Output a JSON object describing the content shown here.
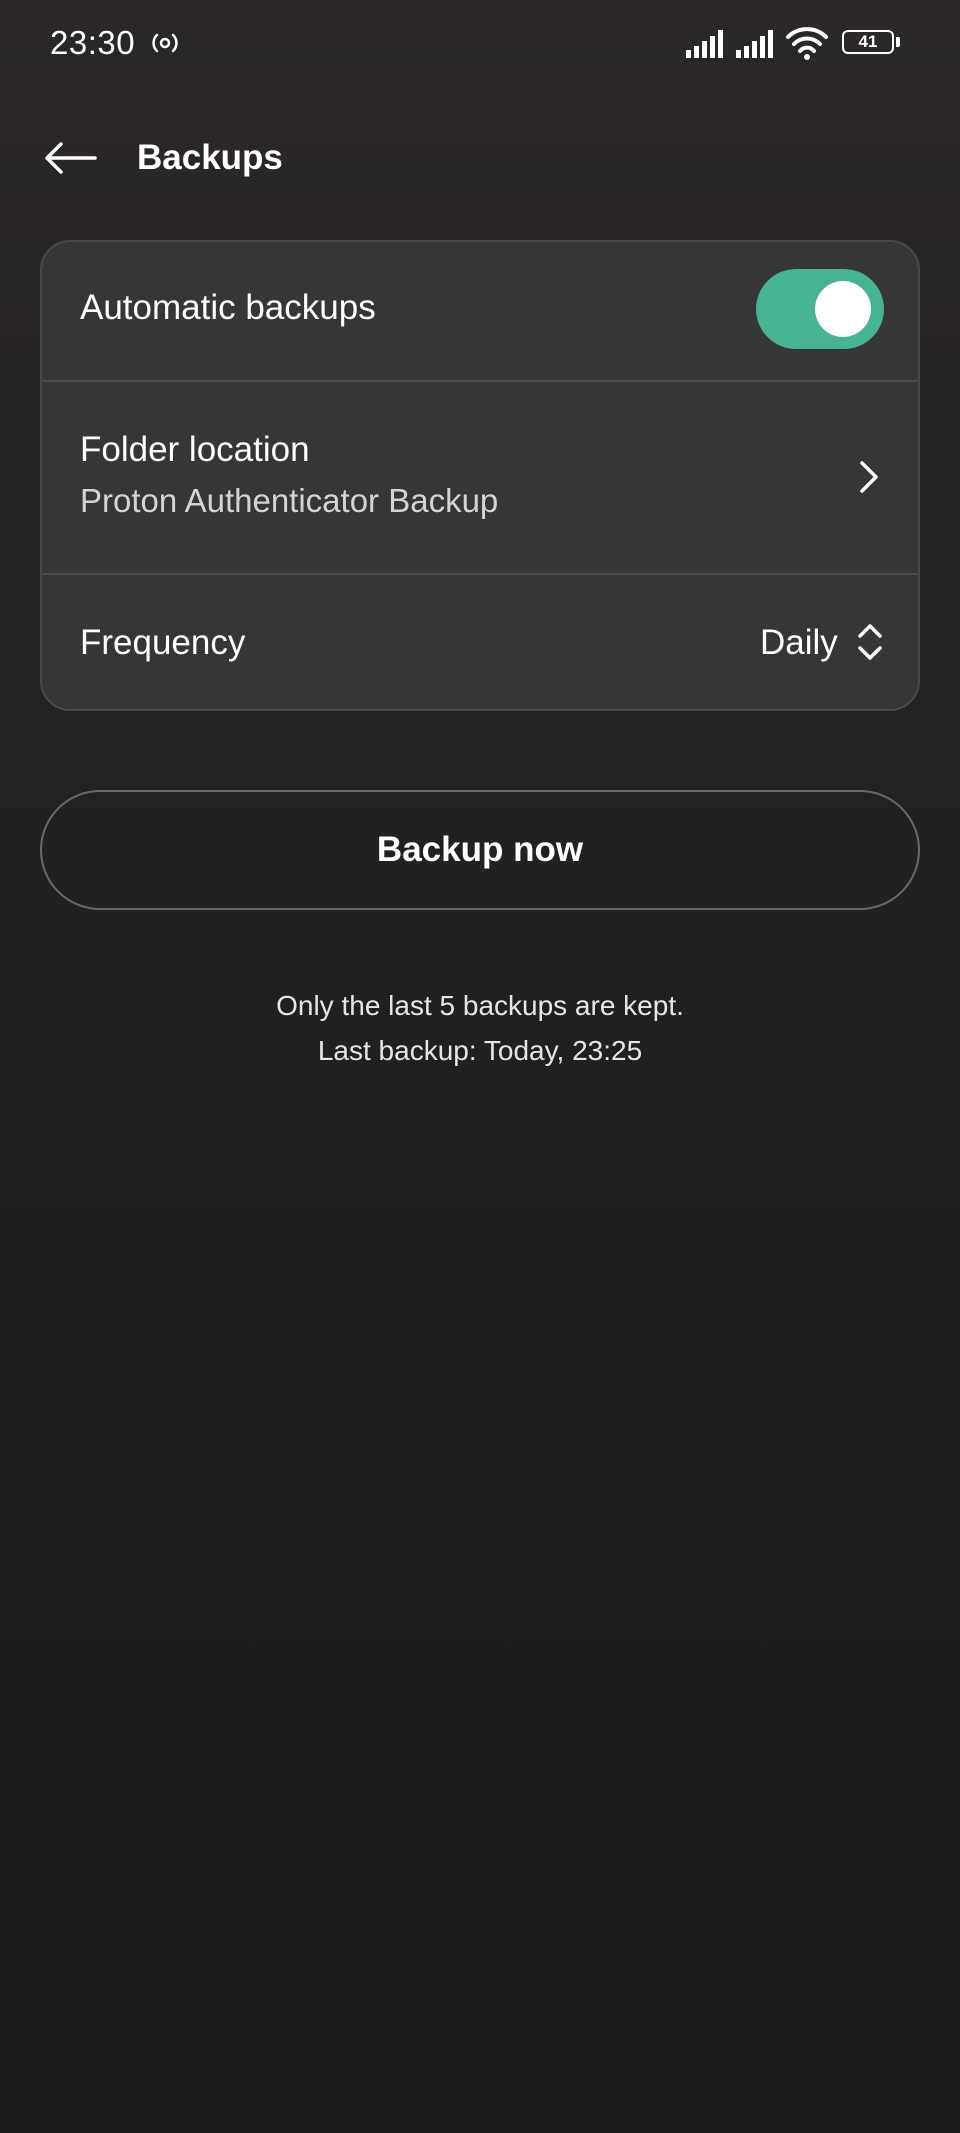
{
  "status_bar": {
    "time": "23:30",
    "battery_level": "41",
    "icons": [
      "radio-icon",
      "signal-icon",
      "signal-icon",
      "wifi-icon",
      "battery-icon"
    ]
  },
  "header": {
    "title": "Backups",
    "back_icon": "arrow-left-icon"
  },
  "settings": {
    "automatic_backups": {
      "label": "Automatic backups",
      "enabled": true
    },
    "folder_location": {
      "label": "Folder location",
      "value": "Proton Authenticator Backup",
      "icon": "chevron-right-icon"
    },
    "frequency": {
      "label": "Frequency",
      "value": "Daily",
      "icon": "unfold-icon"
    }
  },
  "actions": {
    "backup_now_label": "Backup now"
  },
  "info": {
    "retention_text": "Only the last 5 backups are kept.",
    "last_backup_text": "Last backup: Today, 23:25"
  },
  "colors": {
    "accent": "#46b393",
    "card_background": "#373636",
    "page_background": "#222120"
  }
}
